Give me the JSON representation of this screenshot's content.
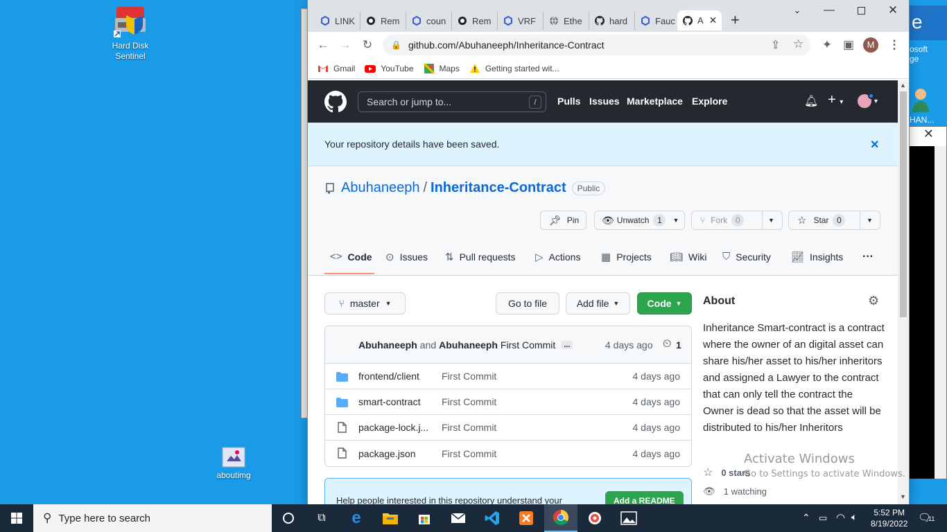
{
  "desktop": {
    "icons": [
      {
        "label": "Hard Disk Sentinel"
      },
      {
        "label": "aboutimg"
      }
    ],
    "right_edge": {
      "microsoft_edge_text": "osoft\nge",
      "user_label": "HAN..."
    }
  },
  "browser": {
    "tabs": [
      {
        "title": "LINK",
        "icon": "hexagon-icon"
      },
      {
        "title": "Rem",
        "icon": "remix-icon"
      },
      {
        "title": "coun",
        "icon": "hexagon-icon"
      },
      {
        "title": "Rem",
        "icon": "remix-icon"
      },
      {
        "title": "VRF",
        "icon": "hexagon-icon"
      },
      {
        "title": "Ethe",
        "icon": "globe-icon"
      },
      {
        "title": "hard",
        "icon": "github-icon"
      },
      {
        "title": "Fauc",
        "icon": "hexagon-icon"
      },
      {
        "title": "A",
        "icon": "github-icon",
        "active": true
      }
    ],
    "url": "github.com/Abuhaneeph/Inheritance-Contract",
    "profile_initial": "M",
    "bookmarks": [
      {
        "label": "Gmail",
        "icon": "gmail-icon"
      },
      {
        "label": "YouTube",
        "icon": "youtube-icon"
      },
      {
        "label": "Maps",
        "icon": "maps-icon"
      },
      {
        "label": "Getting started wit...",
        "icon": "warning-icon"
      }
    ]
  },
  "github": {
    "search_placeholder": "Search or jump to...",
    "search_shortcut": "/",
    "nav": [
      "Pulls",
      "Issues",
      "Marketplace",
      "Explore"
    ],
    "flash_message": "Your repository details have been saved.",
    "owner": "Abuhaneeph",
    "separator": "/",
    "repo": "Inheritance-Contract",
    "visibility": "Public",
    "actions": {
      "pin": "Pin",
      "unwatch": "Unwatch",
      "watch_count": "1",
      "fork": "Fork",
      "fork_count": "0",
      "star": "Star",
      "star_count": "0"
    },
    "tabs": [
      "Code",
      "Issues",
      "Pull requests",
      "Actions",
      "Projects",
      "Wiki",
      "Security",
      "Insights"
    ],
    "more": "···",
    "branch": "master",
    "go_to_file": "Go to file",
    "add_file": "Add file",
    "code_btn": "Code",
    "commit": {
      "author1": "Abuhaneeph",
      "and": "and",
      "author2": "Abuhaneeph",
      "message": "First Commit",
      "ellipsis": "...",
      "time": "4 days ago",
      "count": "1"
    },
    "files": [
      {
        "name": "frontend/client",
        "type": "folder",
        "message": "First Commit",
        "date": "4 days ago"
      },
      {
        "name": "smart-contract",
        "type": "folder",
        "message": "First Commit",
        "date": "4 days ago"
      },
      {
        "name": "package-lock.j...",
        "type": "file",
        "message": "First Commit",
        "date": "4 days ago"
      },
      {
        "name": "package.json",
        "type": "file",
        "message": "First Commit",
        "date": "4 days ago"
      }
    ],
    "readme_prompt": "Help people interested in this repository understand your",
    "add_readme": "Add a README",
    "about": {
      "heading": "About",
      "description": "Inheritance Smart-contract is a contract where the owner of an digital asset can share his/her asset to his/her inheritors and assigned a Lawyer to the contract that can only tell the contract the Owner is dead so that the asset will be distributed to his/her Inheritors",
      "stars": "0 stars",
      "watching": "1 watching"
    }
  },
  "watermark": {
    "line1": "Activate Windows",
    "line2": "Go to Settings to activate Windows."
  },
  "taskbar": {
    "search_placeholder": "Type here to search",
    "time": "5:52 PM",
    "date": "8/19/2022",
    "notification_count": "11"
  }
}
